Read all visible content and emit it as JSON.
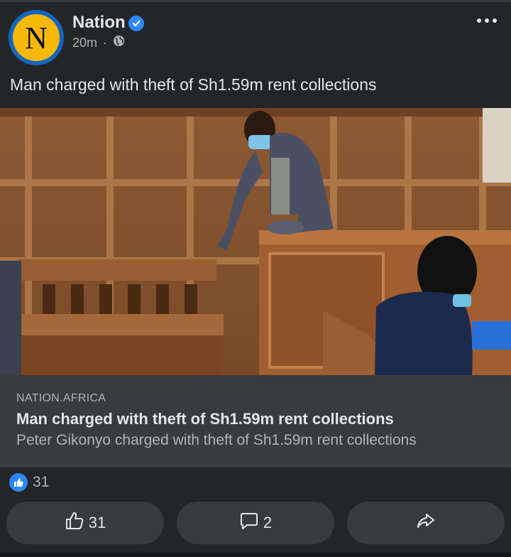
{
  "post": {
    "page_name": "Nation",
    "avatar_letter": "N",
    "time_ago": "20m",
    "text": "Man charged with theft of Sh1.59m rent collections"
  },
  "link_preview": {
    "domain": "NATION.AFRICA",
    "title": "Man charged with theft of Sh1.59m rent collections",
    "description": "Peter Gikonyo charged with theft of Sh1.59m rent collections"
  },
  "reactions": {
    "count": "31"
  },
  "actions": {
    "like_count": "31",
    "comment_count": "2"
  },
  "colors": {
    "background": "#242526",
    "accent_blue": "#2d88ff",
    "avatar_yellow": "#f6b90a",
    "card": "#3a3b3c"
  },
  "icons": [
    "verified-icon",
    "globe-icon",
    "more-icon",
    "like-reaction-icon",
    "thumbs-up-icon",
    "comment-icon",
    "share-icon"
  ]
}
